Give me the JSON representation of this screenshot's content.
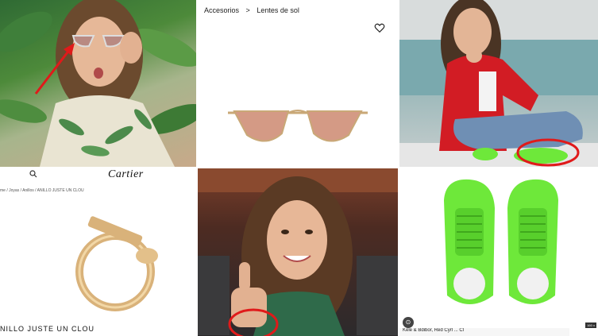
{
  "tile_sunglasses_product": {
    "breadcrumb_1": "Accesorios",
    "breadcrumb_sep": ">",
    "breadcrumb_2": "Lentes de sol",
    "heart_icon": "heart-outline-icon"
  },
  "tile_ring_product": {
    "brand": "Cartier",
    "search_icon": "search-icon",
    "breadcrumb": "me  /  Joyas  /  Anillos  /  ANILLO JUSTE UN CLOU",
    "product_name": "NILLO JUSTE UN CLOU"
  },
  "tile_sneakers_product": {
    "lens_icon": "lens-icon",
    "caption": "Kele & Bdibor, Red Cyrl ... Cl",
    "size_badge": "160 x"
  },
  "highlight_color": "#e01a1a",
  "sneaker_color": "#6ee83a"
}
